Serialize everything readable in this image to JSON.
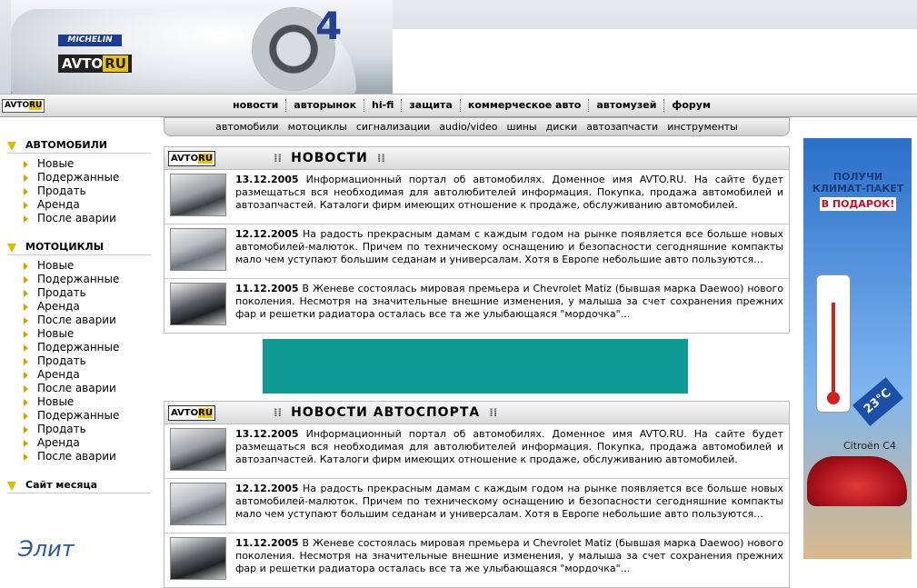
{
  "header": {
    "michelin_label": "MICHELIN",
    "logo_left": "AVTO",
    "logo_right": "RU",
    "race_number": "4"
  },
  "nav": {
    "logo_left": "AVTO",
    "logo_right": "RU",
    "items": [
      "новости",
      "авторынок",
      "hi-fi",
      "защита",
      "коммерческое авто",
      "автомузей",
      "форум"
    ]
  },
  "subnav": {
    "items": [
      "автомобили",
      "мотоциклы",
      "сигнализации",
      "audio/video",
      "шины",
      "диски",
      "автозапчасти",
      "инструменты"
    ]
  },
  "sidebar": {
    "sections": [
      {
        "title": "АВТОМОБИЛИ",
        "items": [
          "Новые",
          "Подержанные",
          "Продать",
          "Аренда",
          "После аварии"
        ]
      },
      {
        "title": "МОТОЦИКЛЫ",
        "items": [
          "Новые",
          "Подержанные",
          "Продать",
          "Аренда",
          "После аварии",
          "Новые",
          "Подержанные",
          "Продать",
          "Аренда",
          "После аварии",
          "Новые",
          "Подержанные",
          "Продать",
          "Аренда",
          "После аварии"
        ]
      },
      {
        "title": "Сайт месяца",
        "items": []
      }
    ],
    "partner_text": "Элит"
  },
  "news": {
    "logo_left": "AVTO",
    "logo_right": "RU",
    "title": "НОВОСТИ",
    "items": [
      {
        "date": "13.12.2005",
        "text": " Информационный портал об автомобилях. Доменное имя AVTO.RU. На сайте будет размещаться вся необходимая для автолюбителей информация. Покупка, продажа автомобилей и автозапчастей. Каталоги фирм имеющих отношение к продаже, обслуживанию автомобилей."
      },
      {
        "date": "12.12.2005",
        "text": " На радость прекрасным дамам с каждым годом на рынке появляется все больше новых автомобилей-малюток. Причем по техническому оснащению и безопасности сегодняшние компакты мало чем уступают большим седанам и универсалам. Хотя в Европе небольшие авто пользуются..."
      },
      {
        "date": "11.12.2005",
        "text": " В Женеве состоялась мировая премьера и Chevrolet Matiz (бывшая марка Daewoo) нового поколения. Несмотря на значительные внешние изменения, у малыша за счет сохранения прежних фар и решетки радиатора осталась все та же улыбающаяся \"мордочка\"..."
      }
    ]
  },
  "sport": {
    "logo_left": "AVTO",
    "logo_right": "RU",
    "title": "НОВОСТИ АВТОСПОРТА",
    "items": [
      {
        "date": "13.12.2005",
        "text": " Информационный портал об автомобилях. Доменное имя AVTO.RU. На сайте будет размещаться вся необходимая для автолюбителей информация. Покупка, продажа автомобилей и автозапчастей. Каталоги фирм имеющих отношение к продаже, обслуживанию автомобилей."
      },
      {
        "date": "12.12.2005",
        "text": " На радость прекрасным дамам с каждым годом на рынке появляется все больше новых автомобилей-малюток. Причем по техническому оснащению и безопасности сегодняшние компакты мало чем уступают большим седанам и универсалам. Хотя в Европе небольшие авто пользуются..."
      },
      {
        "date": "11.12.2005",
        "text": " В Женеве состоялась мировая премьера и Chevrolet Matiz (бывшая марка Daewoo) нового поколения. Несмотря на значительные внешние изменения, у малыша за счет сохранения прежних фар и решетки радиатора осталась все та же улыбающаяся \"мордочка\"..."
      }
    ]
  },
  "ad": {
    "line1": "ПОЛУЧИ",
    "line2": "КЛИМАТ-ПАКЕТ",
    "line3": "В ПОДАРОК!",
    "temperature": "23°C",
    "brand": "Citroën C4"
  },
  "colors": {
    "banner": "#0f9a96",
    "accent_yellow": "#e8c21a",
    "ad_blue": "#2a6fc9"
  }
}
